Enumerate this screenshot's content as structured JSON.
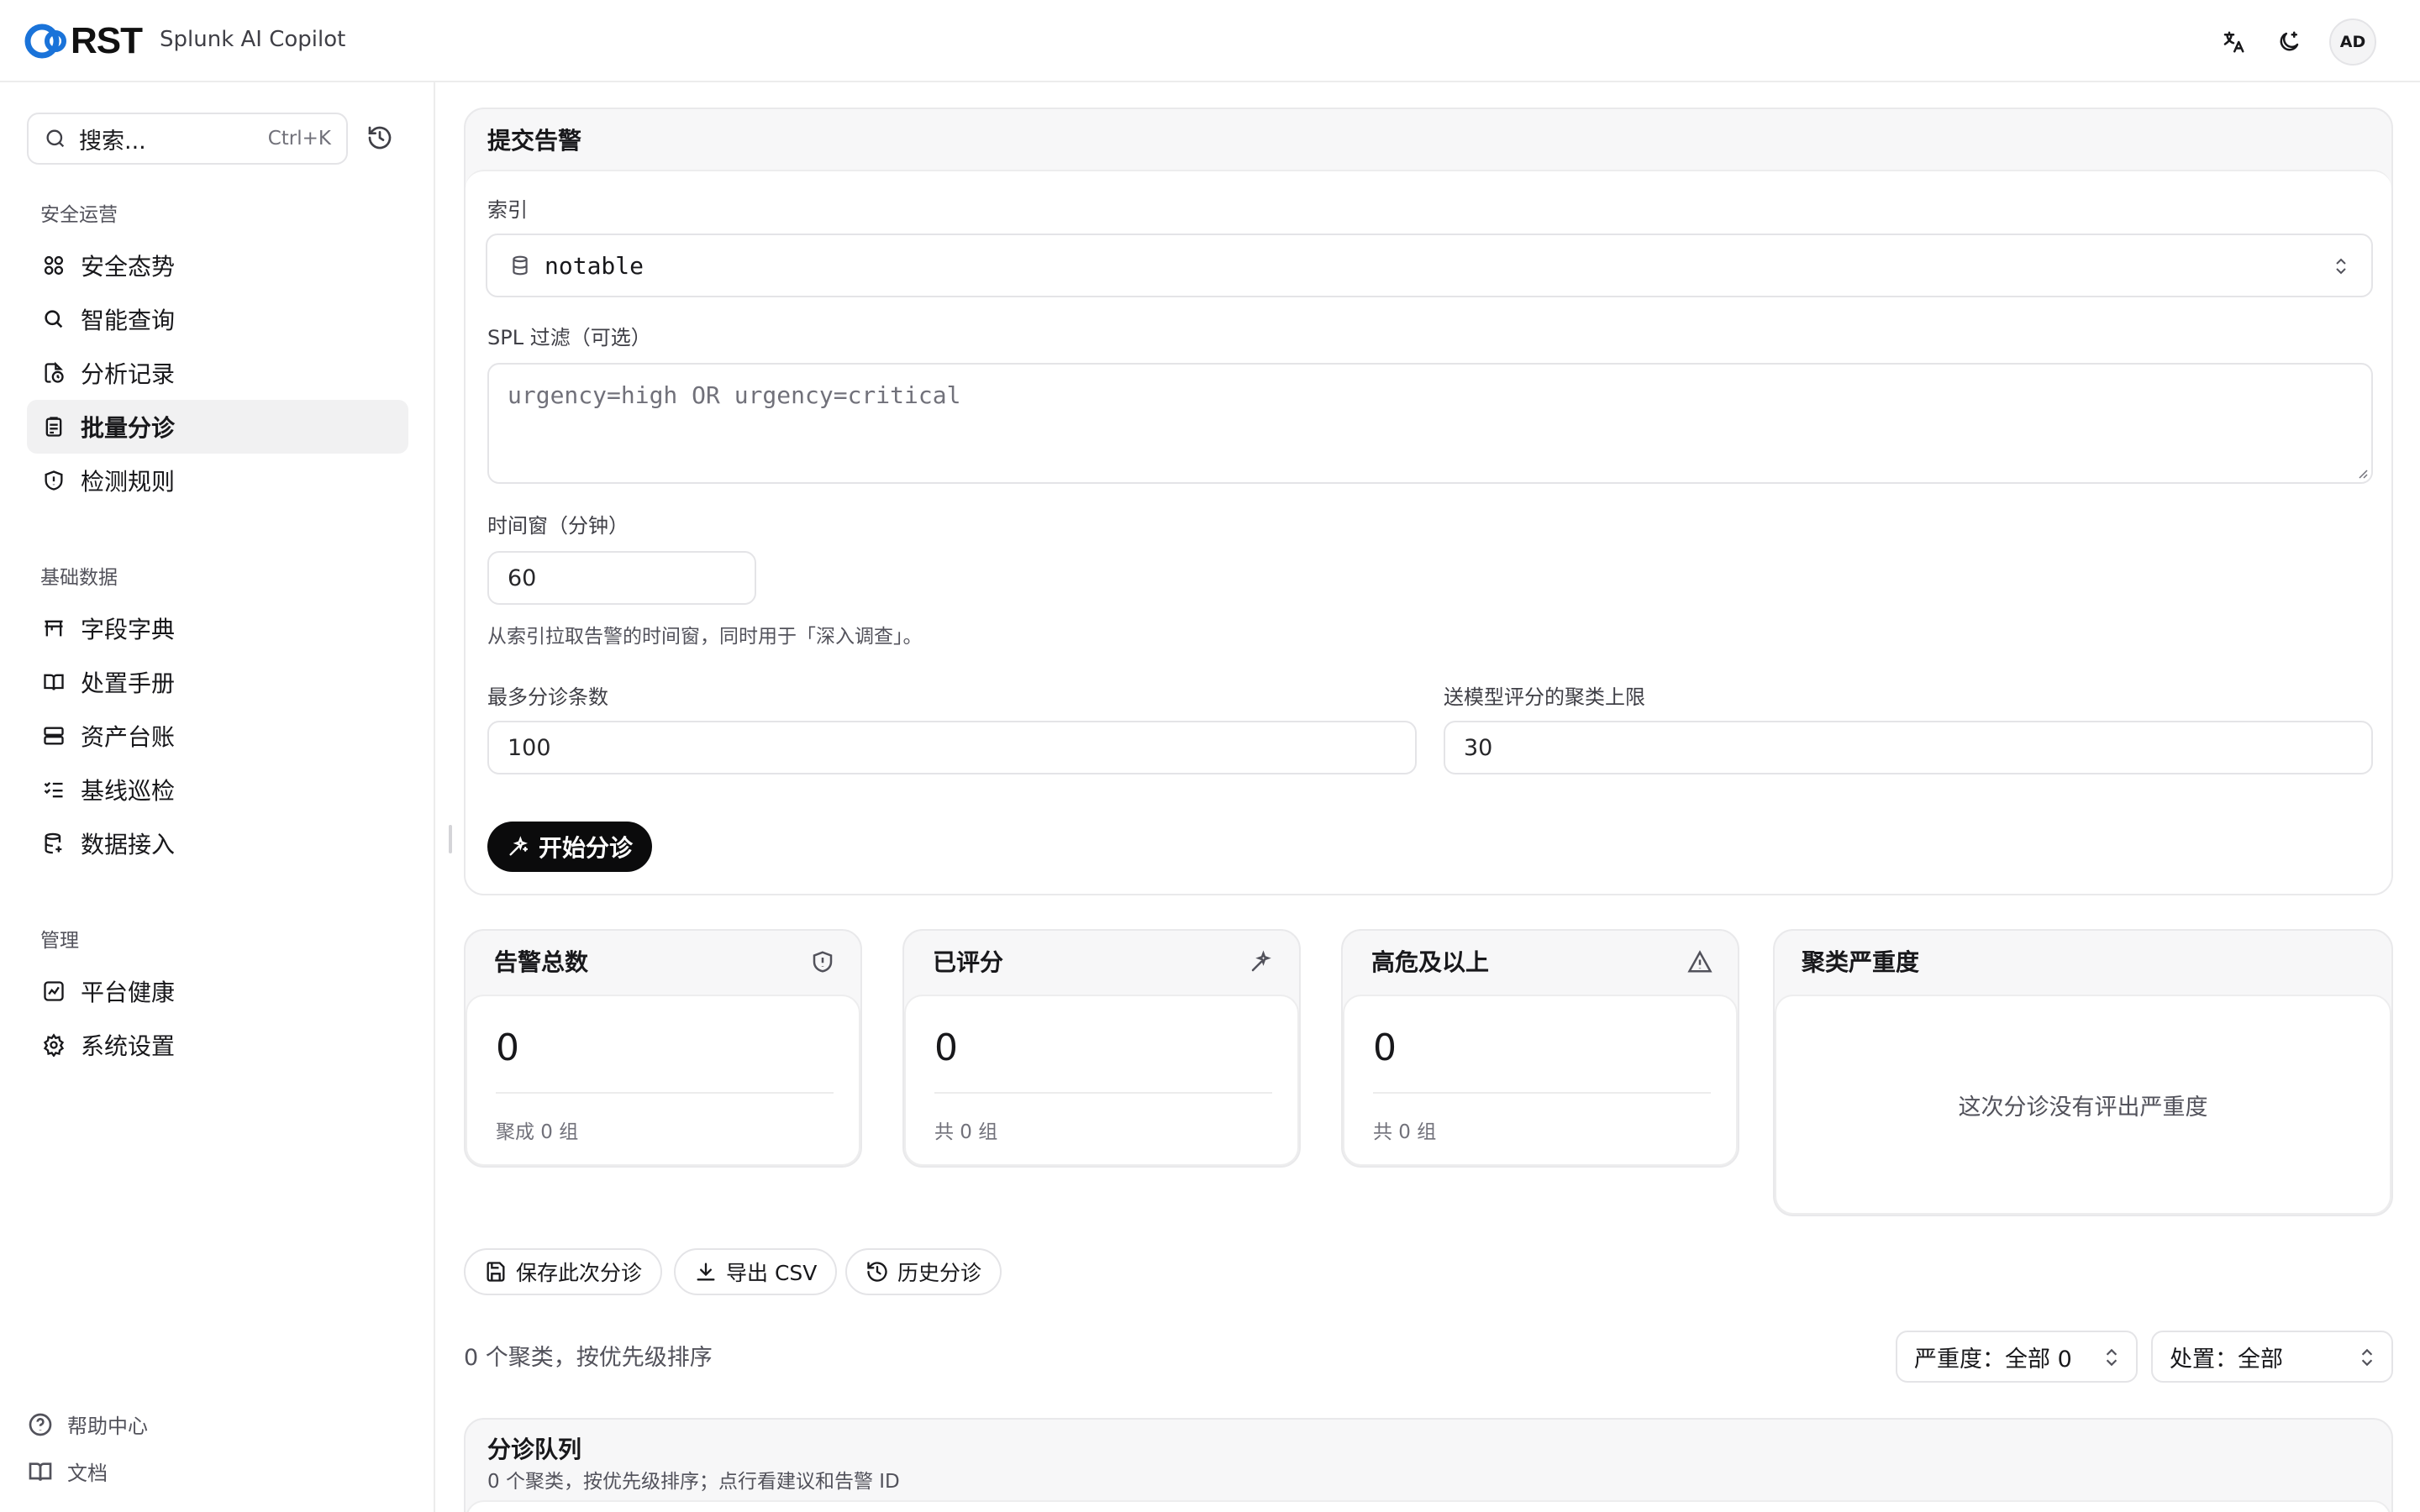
{
  "header": {
    "logo_text": "RST",
    "app_name": "Splunk AI Copilot",
    "avatar": "AD",
    "icons": [
      "translate-icon",
      "theme-toggle-icon"
    ]
  },
  "sidebar": {
    "search_placeholder": "搜索...",
    "search_shortcut": "Ctrl+K",
    "groups": [
      {
        "title": "安全运营",
        "items": [
          {
            "label": "安全态势",
            "icon": "grid-icon"
          },
          {
            "label": "智能查询",
            "icon": "search-icon"
          },
          {
            "label": "分析记录",
            "icon": "history-file-icon"
          },
          {
            "label": "批量分诊",
            "icon": "clipboard-icon",
            "active": true
          },
          {
            "label": "检测规则",
            "icon": "shield-alert-icon"
          }
        ]
      },
      {
        "title": "基础数据",
        "items": [
          {
            "label": "字段字典",
            "icon": "table-icon"
          },
          {
            "label": "处置手册",
            "icon": "book-icon"
          },
          {
            "label": "资产台账",
            "icon": "server-icon"
          },
          {
            "label": "基线巡检",
            "icon": "checklist-icon"
          },
          {
            "label": "数据接入",
            "icon": "database-icon"
          }
        ]
      },
      {
        "title": "管理",
        "items": [
          {
            "label": "平台健康",
            "icon": "chart-icon"
          },
          {
            "label": "系统设置",
            "icon": "gear-icon"
          }
        ]
      }
    ],
    "footer": [
      {
        "label": "帮助中心",
        "icon": "help-icon"
      },
      {
        "label": "文档",
        "icon": "book-open-icon"
      }
    ]
  },
  "submit": {
    "title": "提交告警",
    "index_label": "索引",
    "index_value": "notable",
    "spl_label": "SPL 过滤（可选）",
    "spl_placeholder": "urgency=high OR urgency=critical",
    "window_label": "时间窗（分钟）",
    "window_value": "60",
    "window_hint": "从索引拉取告警的时间窗，同时用于「深入调查」。",
    "max_label": "最多分诊条数",
    "max_value": "100",
    "cluster_label": "送模型评分的聚类上限",
    "cluster_value": "30",
    "start_button": "开始分诊"
  },
  "stats": [
    {
      "title": "告警总数",
      "value": "0",
      "sub": "聚成 0 组",
      "icon": "shield-icon"
    },
    {
      "title": "已评分",
      "value": "0",
      "sub": "共 0 组",
      "icon": "sparkle-icon"
    },
    {
      "title": "高危及以上",
      "value": "0",
      "sub": "共 0 组",
      "icon": "warning-icon"
    }
  ],
  "severity_card": {
    "title": "聚类严重度",
    "empty": "这次分诊没有评出严重度"
  },
  "actions": {
    "save": "保存此次分诊",
    "export": "导出 CSV",
    "history": "历史分诊"
  },
  "list": {
    "summary": "0 个聚类，按优先级排序",
    "severity_filter": "严重度：全部 0",
    "disposition_filter": "处置：全部"
  },
  "queue": {
    "title": "分诊队列",
    "subtitle": "0 个聚类，按优先级排序；点行看建议和告警 ID"
  },
  "colors": {
    "brand_blue": "#1a73d9",
    "primary_button": "#0b0b0c",
    "card_bg": "#f7f7f8"
  }
}
